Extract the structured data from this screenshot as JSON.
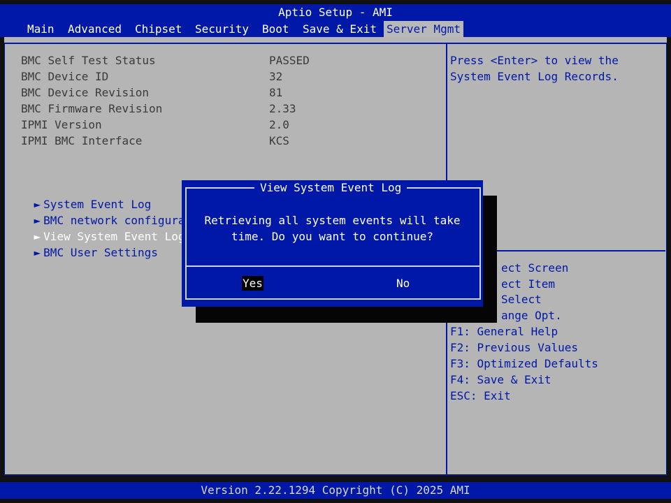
{
  "app": {
    "title": "Aptio Setup - AMI"
  },
  "tabs": [
    {
      "label": "Main"
    },
    {
      "label": "Advanced"
    },
    {
      "label": "Chipset"
    },
    {
      "label": "Security"
    },
    {
      "label": "Boot"
    },
    {
      "label": "Save & Exit"
    },
    {
      "label": "Server Mgmt",
      "active": true
    }
  ],
  "info": [
    {
      "label": "BMC Self Test Status",
      "value": "PASSED"
    },
    {
      "label": "BMC Device ID",
      "value": "32"
    },
    {
      "label": "BMC Device Revision",
      "value": "81"
    },
    {
      "label": "BMC Firmware Revision",
      "value": "2.33"
    },
    {
      "label": "IPMI Version",
      "value": "2.0"
    },
    {
      "label": "IPMI BMC Interface",
      "value": "KCS"
    }
  ],
  "menu": [
    {
      "label": "System Event Log"
    },
    {
      "label": "BMC network configuratio"
    },
    {
      "label": "View System Event Log",
      "selected": true
    },
    {
      "label": "BMC User Settings"
    }
  ],
  "help": {
    "description": [
      "Press <Enter> to view the",
      "System Event Log Records."
    ],
    "keys_partial": [
      "ect Screen",
      "ect Item",
      "Select",
      "ange Opt."
    ],
    "keys": [
      "F1: General Help",
      "F2: Previous Values",
      "F3: Optimized Defaults",
      "F4: Save & Exit",
      "ESC: Exit"
    ]
  },
  "dialog": {
    "title": "View System Event Log",
    "message": "Retrieving all system events will take\ntime. Do you want to continue?",
    "yes_label": "Yes",
    "no_label": "No"
  },
  "footer": {
    "text": "Version 2.22.1294 Copyright (C) 2025 AMI"
  },
  "colors": {
    "bios_blue": "#0018a8",
    "panel_gray": "#b5b5b5",
    "text_gray": "#3a3a3a"
  }
}
